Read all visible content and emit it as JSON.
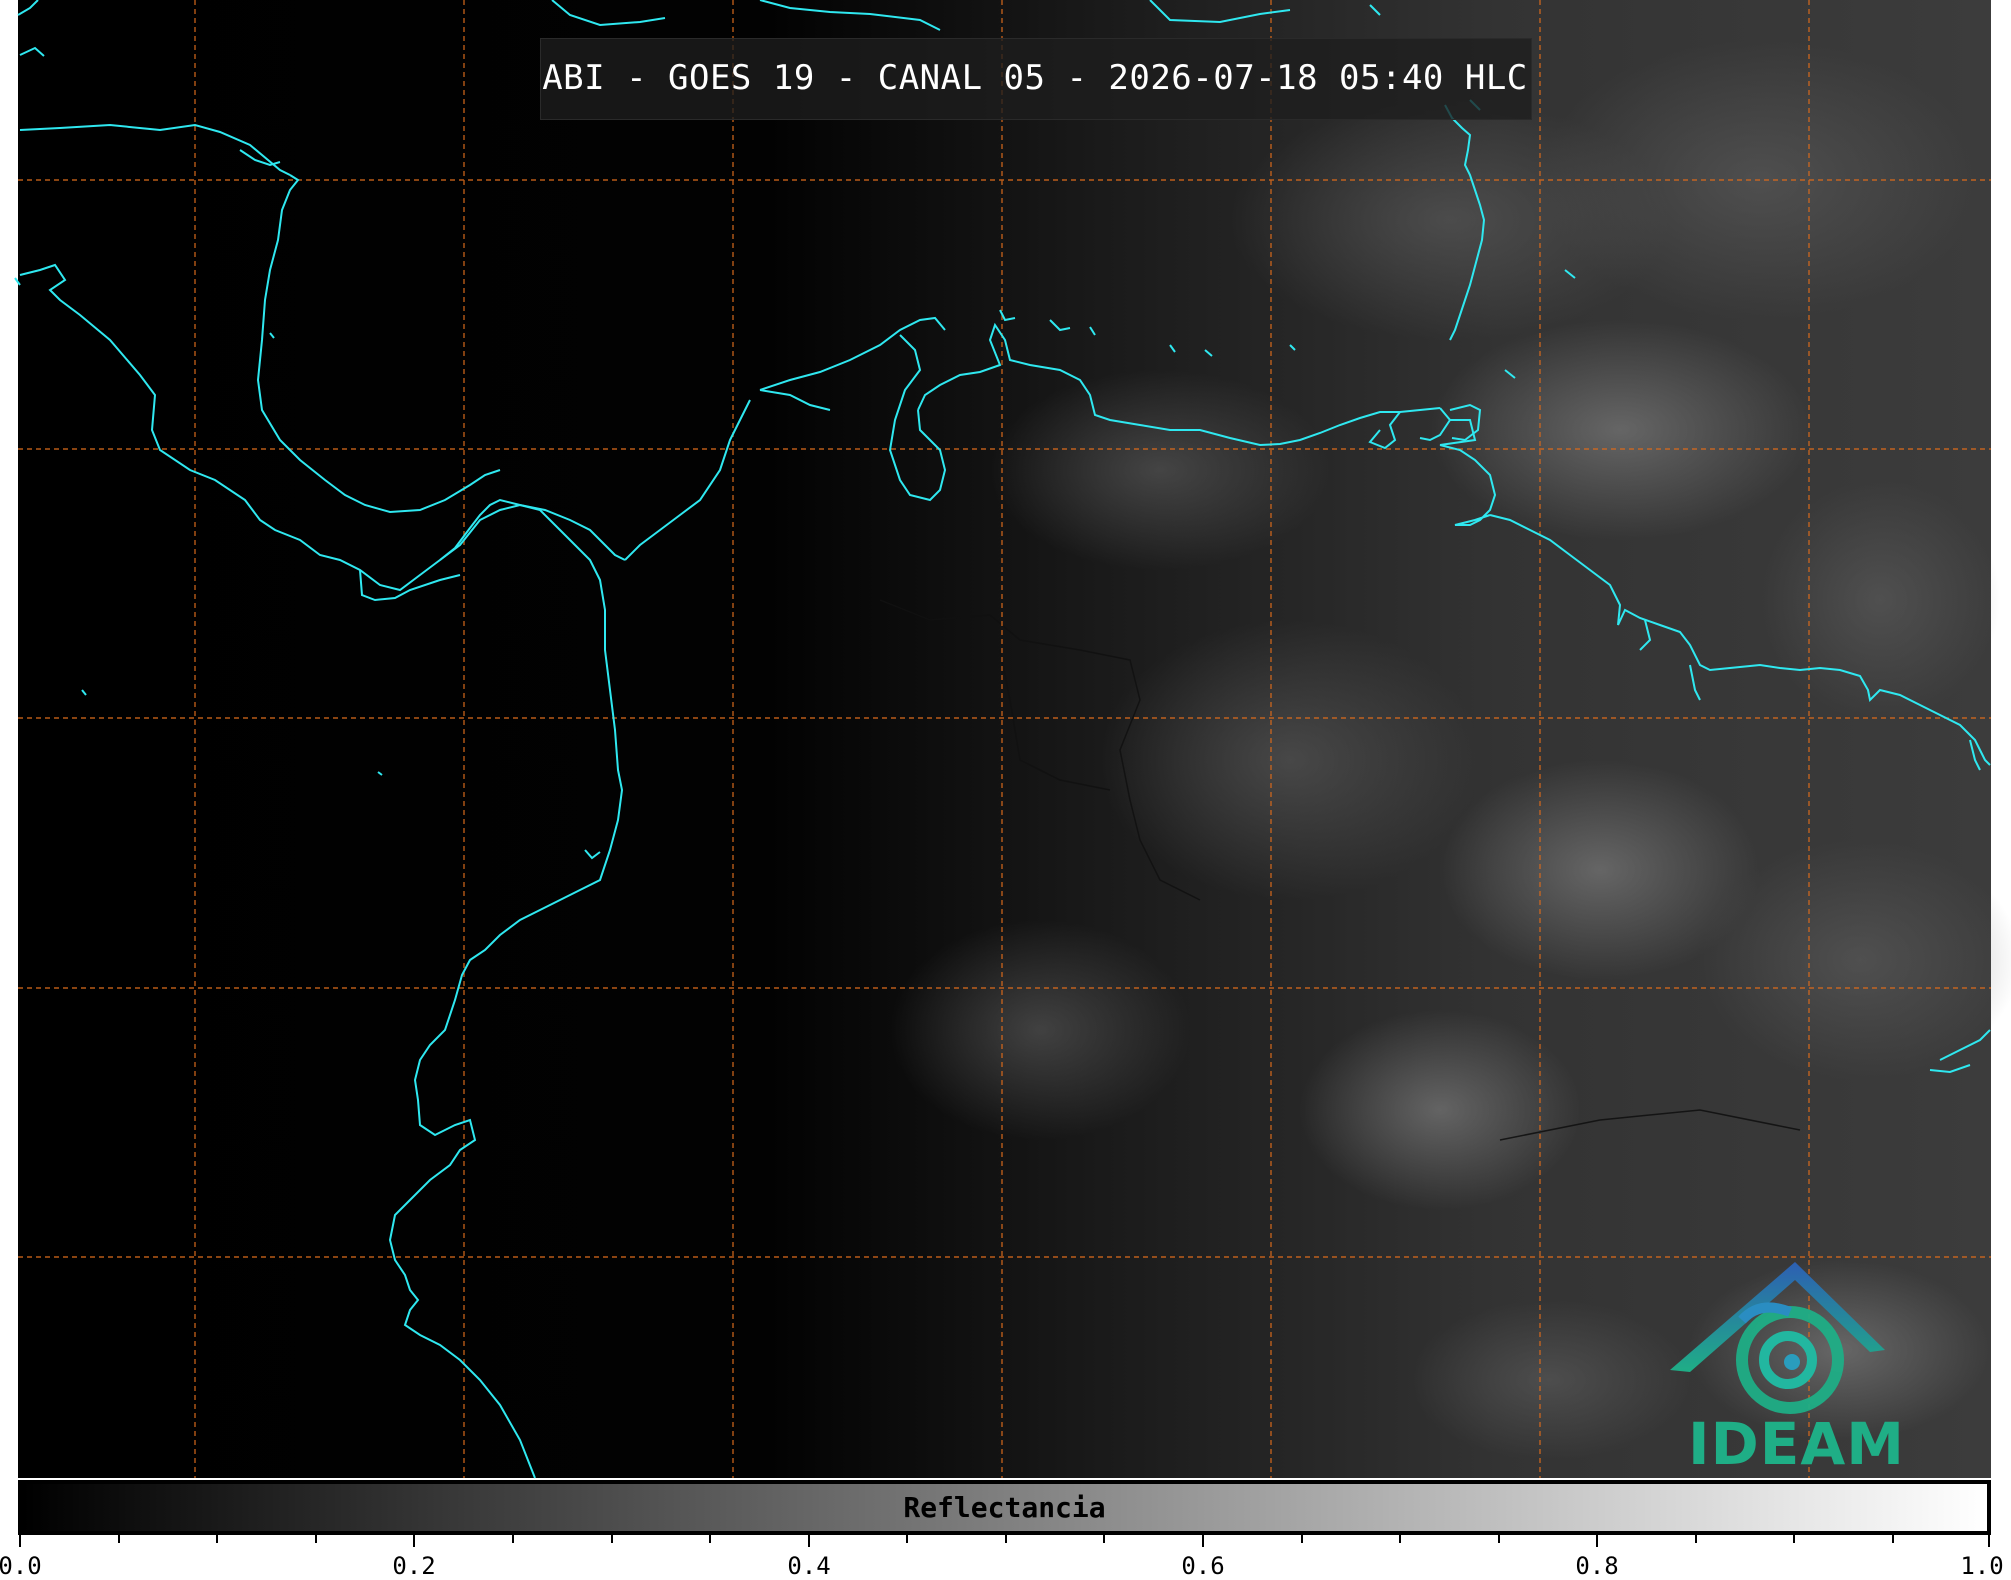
{
  "title": "ABI - GOES 19 - CANAL 05 - 2026-07-18 05:40 HLC",
  "colorbar": {
    "label": "Reflectancia",
    "ticks": [
      "0.0",
      "0.2",
      "0.4",
      "0.6",
      "0.8",
      "1.0"
    ],
    "tick_values": [
      0.0,
      0.2,
      0.4,
      0.6,
      0.8,
      1.0
    ],
    "color_low": "#000000",
    "color_high": "#ffffff"
  },
  "map": {
    "coastline_color": "#2fe8f0",
    "gridline_color": "#d96a1c",
    "background": "#000000"
  },
  "logo": {
    "text": "IDEAM",
    "icon": "ideam-logo-icon",
    "color": "#1fae86"
  }
}
